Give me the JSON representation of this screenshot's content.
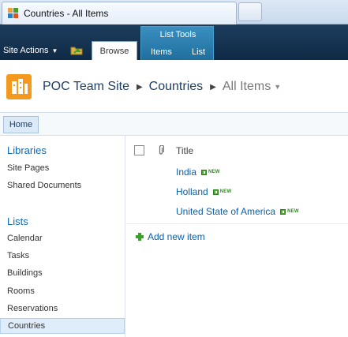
{
  "browser": {
    "tab_title": "Countries - All Items"
  },
  "ribbon": {
    "site_actions": "Site Actions",
    "browse_tab": "Browse",
    "contextual_group": "List Tools",
    "items_tab": "Items",
    "list_tab": "List"
  },
  "breadcrumb": {
    "site": "POC Team Site",
    "list": "Countries",
    "view": "All Items"
  },
  "topnav": {
    "home": "Home"
  },
  "quicklaunch": {
    "libraries_heading": "Libraries",
    "libraries": [
      "Site Pages",
      "Shared Documents"
    ],
    "lists_heading": "Lists",
    "lists": [
      "Calendar",
      "Tasks",
      "Buildings",
      "Rooms",
      "Reservations",
      "Countries"
    ],
    "selected": "Countries"
  },
  "list_view": {
    "column_title": "Title",
    "items": [
      {
        "title": "India",
        "badge": "NEW"
      },
      {
        "title": "Holland",
        "badge": "NEW"
      },
      {
        "title": "United State of America",
        "badge": "NEW"
      }
    ],
    "add_new": "Add new item"
  },
  "colors": {
    "ribbon_dark": "#0f2a45",
    "list_tools": "#1f6f9e",
    "link_blue": "#0f5da7",
    "heading_blue": "#0e69b3",
    "logo_orange": "#f39a1e",
    "new_green": "#4caf34"
  },
  "icons": {
    "tab_favicon": "sharepoint-favicon-icon",
    "nav_folder": "navigate-up-folder-icon",
    "logo": "site-logo-icon",
    "attachment": "paperclip-icon",
    "add": "plus-icon"
  }
}
